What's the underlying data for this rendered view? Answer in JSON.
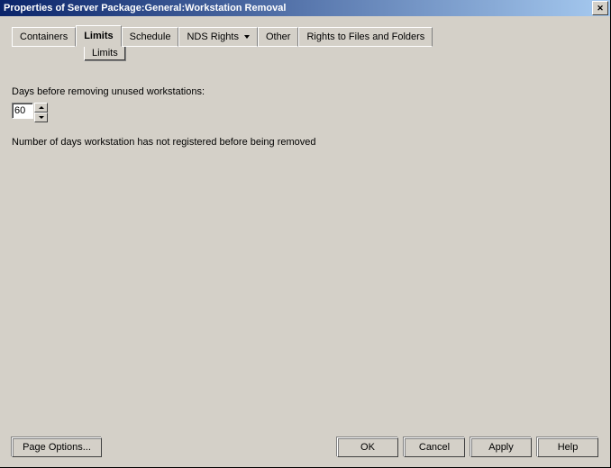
{
  "window": {
    "title": "Properties of Server Package:General:Workstation Removal"
  },
  "tabs": {
    "containers": "Containers",
    "limits": "Limits",
    "schedule": "Schedule",
    "nds_rights": "NDS Rights",
    "other": "Other",
    "rights_files": "Rights to Files and Folders"
  },
  "subtab": {
    "limits": "Limits"
  },
  "panel": {
    "days_label": "Days before removing unused workstations:",
    "days_value": "60",
    "description": "Number of days workstation has not registered before being removed"
  },
  "buttons": {
    "page_options": "Page Options...",
    "ok": "OK",
    "cancel": "Cancel",
    "apply": "Apply",
    "help": "Help"
  }
}
